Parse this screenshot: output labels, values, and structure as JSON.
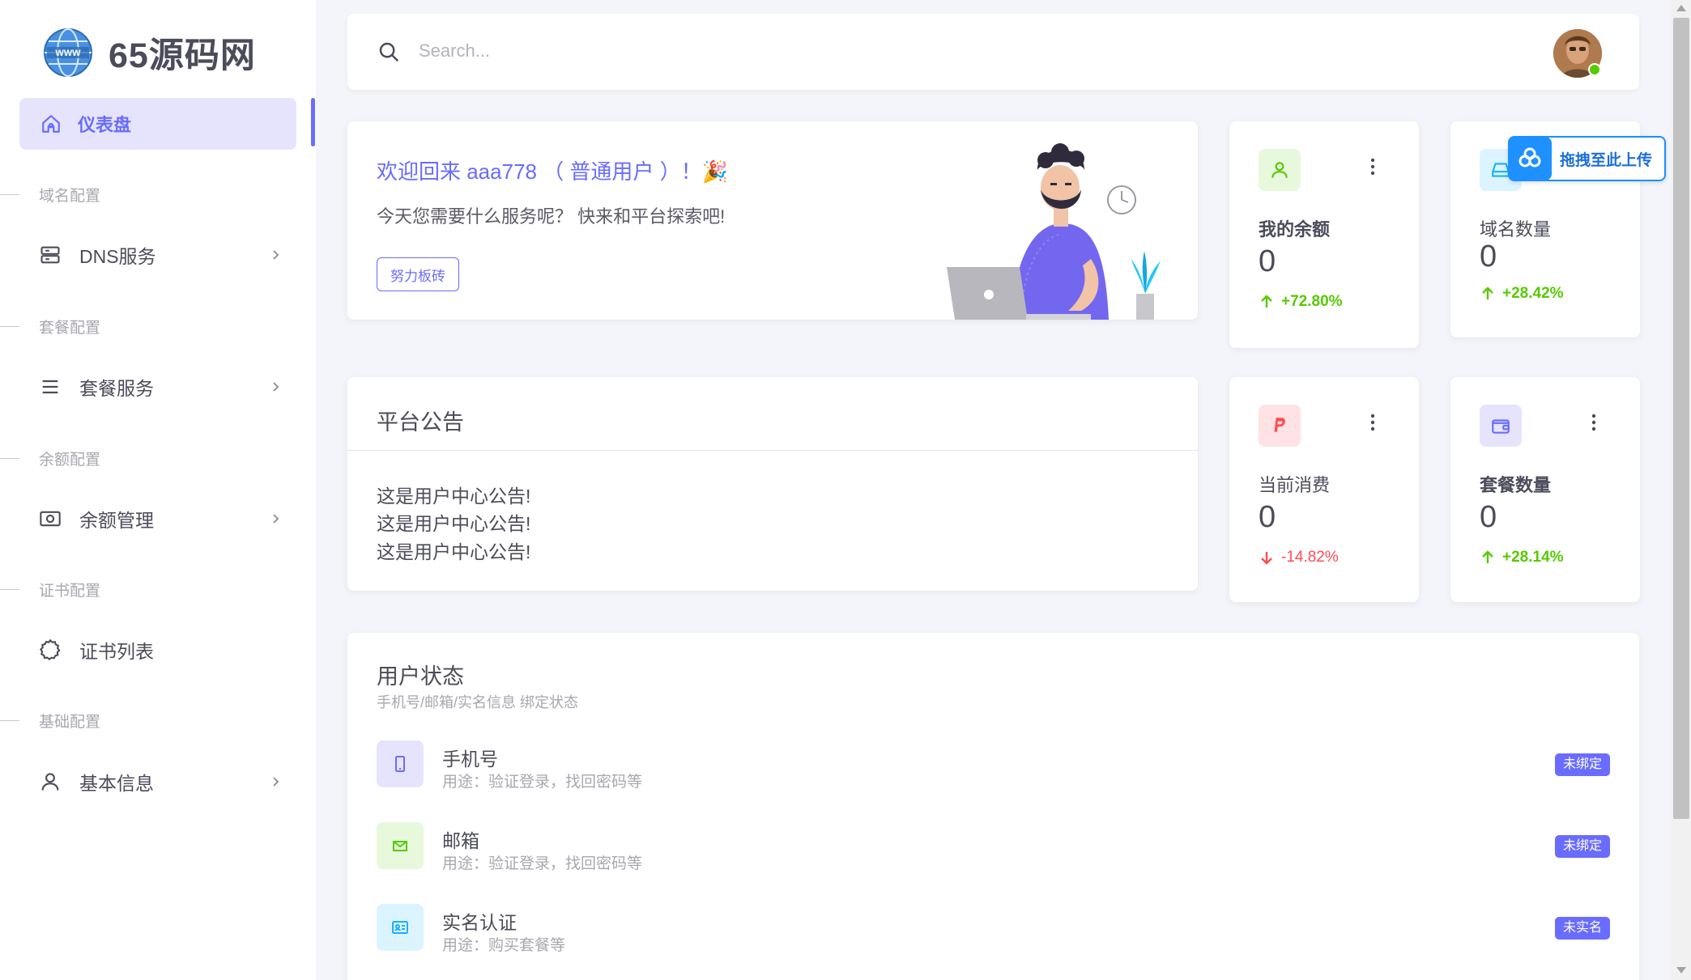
{
  "brand": {
    "name": "65源码网",
    "logo_icon": "globe-www-icon"
  },
  "sidebar": {
    "active": {
      "label": "仪表盘",
      "icon": "home-icon"
    },
    "sections": [
      {
        "header": "域名配置",
        "item": {
          "label": "DNS服务",
          "icon": "server-icon"
        }
      },
      {
        "header": "套餐配置",
        "item": {
          "label": "套餐服务",
          "icon": "menu-icon"
        }
      },
      {
        "header": "余额配置",
        "item": {
          "label": "余额管理",
          "icon": "cash-icon"
        }
      },
      {
        "header": "证书配置",
        "item": {
          "label": "证书列表",
          "icon": "certificate-icon"
        }
      },
      {
        "header": "基础配置",
        "item": {
          "label": "基本信息",
          "icon": "user-icon"
        }
      }
    ]
  },
  "topbar": {
    "search_placeholder": "Search...",
    "search_icon": "search-icon",
    "avatar_status": "online"
  },
  "welcome": {
    "title": "欢迎回来 aaa778 （ 普通用户 ）！🎉",
    "subtitle": "今天您需要什么服务呢？ 快来和平台探索吧!",
    "button": "努力板砖"
  },
  "stats": [
    {
      "title": "我的余额",
      "value": "0",
      "trend": "+72.80%",
      "direction": "up",
      "icon": "user-icon",
      "icon_color": "#56ca00",
      "icon_bg": "#e8f8dd"
    },
    {
      "title": "域名数量",
      "value": "0",
      "trend": "+28.42%",
      "direction": "up",
      "icon": "hard-drive-icon",
      "icon_color": "#16b1ff",
      "icon_bg": "#dcf4ff"
    },
    {
      "title": "当前消费",
      "value": "0",
      "trend": "-14.82%",
      "direction": "down",
      "icon": "paypal-icon",
      "icon_color": "#ff4c51",
      "icon_bg": "#ffe2e3"
    },
    {
      "title": "套餐数量",
      "value": "0",
      "trend": "+28.14%",
      "direction": "up",
      "icon": "wallet-icon",
      "icon_color": "#696cff",
      "icon_bg": "#e6e4fd"
    }
  ],
  "upload_badge": {
    "label": "拖拽至此上传",
    "icon": "cloud-upload-icon"
  },
  "announcement": {
    "title": "平台公告",
    "lines": [
      "这是用户中心公告!",
      "这是用户中心公告!",
      "这是用户中心公告!"
    ]
  },
  "user_status": {
    "title": "用户状态",
    "subtitle": "手机号/邮箱/实名信息 绑定状态",
    "rows": [
      {
        "name": "手机号",
        "desc": "用途：验证登录，找回密码等",
        "badge": "未绑定",
        "icon": "phone-icon",
        "icon_color": "#696cff",
        "icon_bg": "#e6e4fd"
      },
      {
        "name": "邮箱",
        "desc": "用途：验证登录，找回密码等",
        "badge": "未绑定",
        "icon": "mail-icon",
        "icon_color": "#56ca00",
        "icon_bg": "#e8f8dd"
      },
      {
        "name": "实名认证",
        "desc": "用途：购买套餐等",
        "badge": "未实名",
        "icon": "id-card-icon",
        "icon_color": "#16b1ff",
        "icon_bg": "#dcf4ff"
      }
    ]
  },
  "colors": {
    "primary": "#696cff",
    "success": "#56ca00",
    "danger": "#ff4c51",
    "info": "#16b1ff",
    "background": "#f4f5fa"
  }
}
